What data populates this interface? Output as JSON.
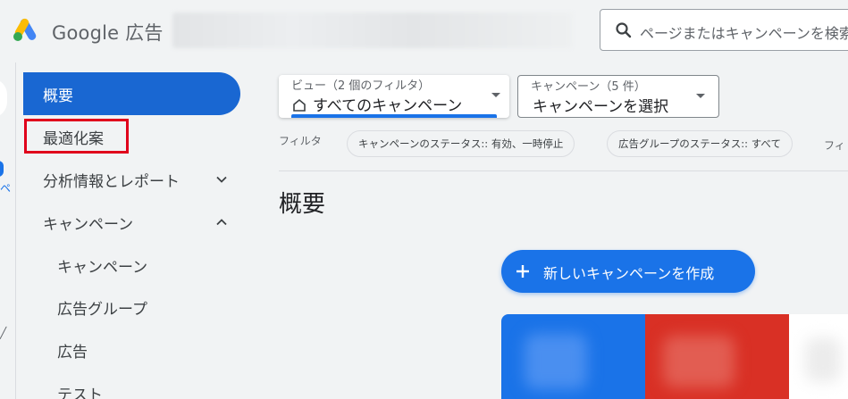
{
  "header": {
    "logo_text": "Google 広告",
    "search_placeholder": "ページまたはキャンペーンを検索"
  },
  "nav": {
    "items": [
      {
        "label": "概要",
        "active": true
      },
      {
        "label": "最適化案"
      },
      {
        "label": "分析情報とレポート",
        "expanded": false
      },
      {
        "label": "キャンペーン",
        "expanded": true
      },
      {
        "label": "キャンペーン"
      },
      {
        "label": "広告グループ"
      },
      {
        "label": "広告"
      },
      {
        "label": "テスト"
      }
    ],
    "rail_label": "ペ"
  },
  "filters": {
    "view_label": "ビュー（2 個のフィルタ）",
    "view_value": "すべてのキャンペーン",
    "campaign_label": "キャンペーン（5 件）",
    "campaign_value": "キャンペーンを選択",
    "filter_label": "フィルタ",
    "chips": [
      "キャンペーンのステータス:: 有効、一時停止",
      "広告グループのステータス:: すべて"
    ],
    "more": "フィ"
  },
  "main": {
    "title": "概要",
    "create_button": "新しいキャンペーンを作成"
  },
  "colors": {
    "accent": "#1a73e8",
    "active_nav": "#1967d2",
    "highlight": "#e0001b",
    "promo_red": "#d93025"
  }
}
